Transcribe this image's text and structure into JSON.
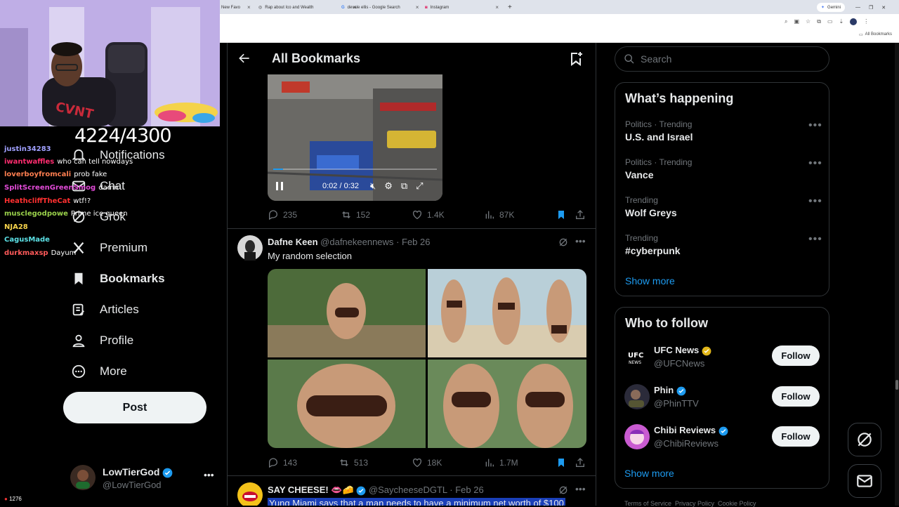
{
  "browser": {
    "tabs": [
      {
        "label": "New Favo"
      },
      {
        "label": "Rap about Ico and Wealth"
      },
      {
        "label": "devale ellis - Google Search"
      },
      {
        "label": "Instagram"
      }
    ],
    "gemini_label": "Gemini",
    "bookmarks_folder": "All Bookmarks"
  },
  "stream": {
    "sub_goal": "4224/4300",
    "viewer_count": "1276",
    "chat": [
      {
        "user": "justin34283",
        "color": "#a0a0ff",
        "msg": ""
      },
      {
        "user": "iwantwaffles",
        "color": "#ff2d6f",
        "msg": "who can tell nowdays"
      },
      {
        "user": "loverboyfromcali",
        "color": "#ff7f50",
        "msg": "prob fake"
      },
      {
        "user": "SplitScreenGreenSmog",
        "color": "#e24bd8",
        "msg": "damn"
      },
      {
        "user": "HeathcliffTheCat",
        "color": "#ff3030",
        "msg": "wtf!?"
      },
      {
        "user": "musclegodpowe",
        "color": "#9ad14b",
        "msg": "Prime ice queen"
      },
      {
        "user": "NJA28",
        "color": "#f6d34b",
        "msg": ""
      },
      {
        "user": "CagusMade",
        "color": "#5ce1e6",
        "msg": ""
      },
      {
        "user": "durkmaxsp",
        "color": "#ff5a5a",
        "msg": "Dayum"
      }
    ]
  },
  "sidebar": {
    "items": [
      {
        "label": "Notifications",
        "icon": "bell-icon"
      },
      {
        "label": "Chat",
        "icon": "envelope-icon"
      },
      {
        "label": "Grok",
        "icon": "grok-icon"
      },
      {
        "label": "Premium",
        "icon": "x-logo-icon"
      },
      {
        "label": "Bookmarks",
        "icon": "bookmark-icon"
      },
      {
        "label": "Articles",
        "icon": "article-icon"
      },
      {
        "label": "Profile",
        "icon": "person-icon"
      },
      {
        "label": "More",
        "icon": "more-circle-icon"
      }
    ],
    "post_label": "Post",
    "account": {
      "name": "LowTierGod",
      "handle": "@LowTierGod"
    }
  },
  "main": {
    "title": "All Bookmarks",
    "tweets": [
      {
        "video_time": "0:02 / 0:32",
        "replies": "235",
        "reposts": "152",
        "likes": "1.4K",
        "views": "87K"
      },
      {
        "name": "Dafne Keen",
        "handle": "@dafnekeennews",
        "date": "· Feb 26",
        "text": "My random selection",
        "replies": "143",
        "reposts": "513",
        "likes": "18K",
        "views": "1.7M"
      },
      {
        "name": "SAY CHEESE! 👄🧀",
        "handle": "@SaycheeseDGTL",
        "date": "· Feb 26",
        "text": "Yung Miami says that a man needs to have a minimum net worth of $100"
      }
    ]
  },
  "right": {
    "search_placeholder": "Search",
    "whats_happening": "What’s happening",
    "trends": [
      {
        "category": "Politics · Trending",
        "name": "U.S. and Israel"
      },
      {
        "category": "Politics · Trending",
        "name": "Vance"
      },
      {
        "category": "Trending",
        "name": "Wolf Greys"
      },
      {
        "category": "Trending",
        "name": "#cyberpunk"
      }
    ],
    "show_more": "Show more",
    "who_to_follow": "Who to follow",
    "follow": [
      {
        "name": "UFC News",
        "handle": "@UFCNews",
        "badge": "gold"
      },
      {
        "name": "Phin",
        "handle": "@PhinTTV",
        "badge": "blue"
      },
      {
        "name": "Chibi Reviews",
        "handle": "@ChibiReviews",
        "badge": "blue"
      }
    ],
    "follow_label": "Follow",
    "show_more_2": "Show more",
    "footer": "Terms of Service  Privacy Policy  Cookie Policy"
  },
  "colors": {
    "accent": "#1d9bf0",
    "background": "#000000",
    "border": "#2f3336"
  }
}
